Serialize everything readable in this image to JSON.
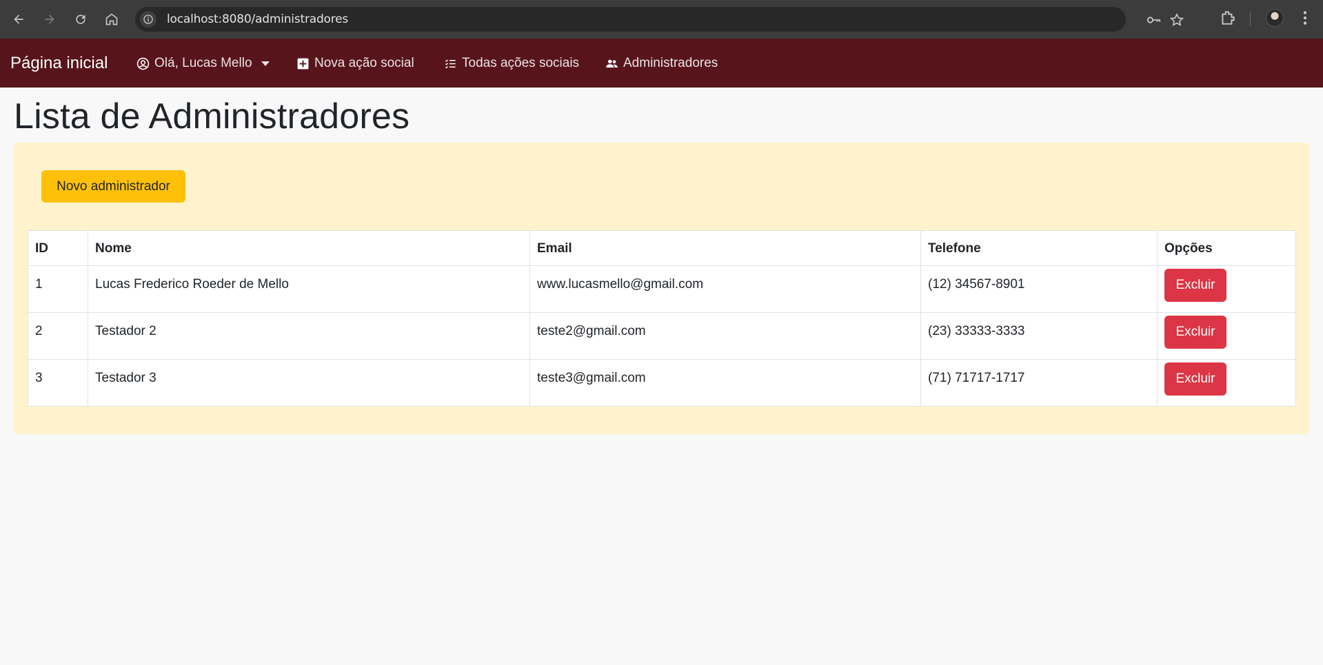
{
  "browser": {
    "url": "localhost:8080/administradores"
  },
  "navbar": {
    "brand": "Página inicial",
    "user_menu": "Olá, Lucas Mello",
    "links": [
      {
        "label": "Nova ação social",
        "icon": "plus-square-icon"
      },
      {
        "label": "Todas ações sociais",
        "icon": "list-icon"
      },
      {
        "label": "Administradores",
        "icon": "people-icon"
      }
    ],
    "color": "#57151b"
  },
  "page": {
    "title": "Lista de Administradores",
    "new_button": "Novo administrador"
  },
  "table": {
    "headers": [
      "ID",
      "Nome",
      "Email",
      "Telefone",
      "Opções"
    ],
    "rows": [
      {
        "id": "1",
        "nome": "Lucas Frederico Roeder de Mello",
        "email": "www.lucasmello@gmail.com",
        "telefone": "(12) 34567-8901",
        "action": "Excluir"
      },
      {
        "id": "2",
        "nome": "Testador 2",
        "email": "teste2@gmail.com",
        "telefone": "(23) 33333-3333",
        "action": "Excluir"
      },
      {
        "id": "3",
        "nome": "Testador 3",
        "email": "teste3@gmail.com",
        "telefone": "(71) 71717-1717",
        "action": "Excluir"
      }
    ]
  },
  "colors": {
    "panel": "#fff3cd",
    "primary_button": "#ffc107",
    "danger_button": "#dc3545"
  }
}
